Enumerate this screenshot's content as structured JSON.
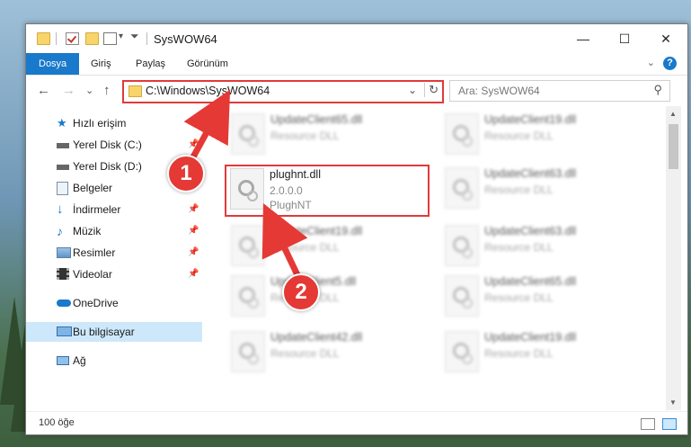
{
  "window": {
    "title": "SysWOW64",
    "minimize_glyph": "—",
    "maximize_glyph": "☐",
    "close_glyph": "✕"
  },
  "ribbon": {
    "tabs": [
      {
        "label": "Dosya",
        "active": true
      },
      {
        "label": "Giriş"
      },
      {
        "label": "Paylaş"
      },
      {
        "label": "Görünüm"
      }
    ],
    "help": "?",
    "collapse": "⌄"
  },
  "nav": {
    "back": "←",
    "forward": "→",
    "recent": "⌄",
    "up": "↑",
    "address": "C:\\Windows\\SysWOW64",
    "address_dropdown": "⌄",
    "refresh": "↻",
    "search_placeholder": "Ara: SysWOW64",
    "search_icon": "⚲"
  },
  "sidebar": {
    "items": [
      {
        "label": "Hızlı erişim",
        "icon": "star-icon"
      },
      {
        "label": "Yerel Disk (C:)",
        "icon": "drive-icon",
        "pin": "📌"
      },
      {
        "label": "Yerel Disk (D:)",
        "icon": "drive-icon",
        "pin": "📌"
      },
      {
        "label": "Belgeler",
        "icon": "document-icon",
        "pin": "📌"
      },
      {
        "label": "İndirmeler",
        "icon": "download-icon",
        "pin": "📌"
      },
      {
        "label": "Müzik",
        "icon": "music-icon",
        "pin": "📌"
      },
      {
        "label": "Resimler",
        "icon": "picture-icon",
        "pin": "📌"
      },
      {
        "label": "Videolar",
        "icon": "video-icon",
        "pin": "📌"
      },
      {
        "label": "OneDrive",
        "icon": "cloud-icon"
      },
      {
        "label": "Bu bilgisayar",
        "icon": "computer-icon",
        "selected": true
      },
      {
        "label": "Ağ",
        "icon": "network-icon"
      }
    ]
  },
  "files": [
    {
      "name": "UpdateClient65.dll",
      "line1": "Resource DLL"
    },
    {
      "name": "UpdateClient19.dll",
      "line1": "Resource DLL"
    },
    {
      "name": "plughnt.dll",
      "line1": "2.0.0.0",
      "line2": "PlughNT",
      "highlighted": true
    },
    {
      "name": "UpdateClient63.dll",
      "line1": "Resource DLL"
    },
    {
      "name": "UpdateClient19.dll",
      "line1": "Resource DLL"
    },
    {
      "name": "UpdateClient63.dll",
      "line1": "Resource DLL"
    },
    {
      "name": "UpdateClient5.dll",
      "line1": "Resource DLL"
    },
    {
      "name": "UpdateClient65.dll",
      "line1": "Resource DLL"
    },
    {
      "name": "UpdateClient42.dll",
      "line1": "Resource DLL"
    },
    {
      "name": "UpdateClient19.dll",
      "line1": "Resource DLL"
    }
  ],
  "status": {
    "item_count": "100 öğe"
  },
  "callouts": {
    "one": "1",
    "two": "2"
  },
  "colors": {
    "accent": "#1979ca",
    "highlight_red": "#e03a3a",
    "badge_red": "#e53935",
    "selected_bg": "#cde8fb"
  }
}
